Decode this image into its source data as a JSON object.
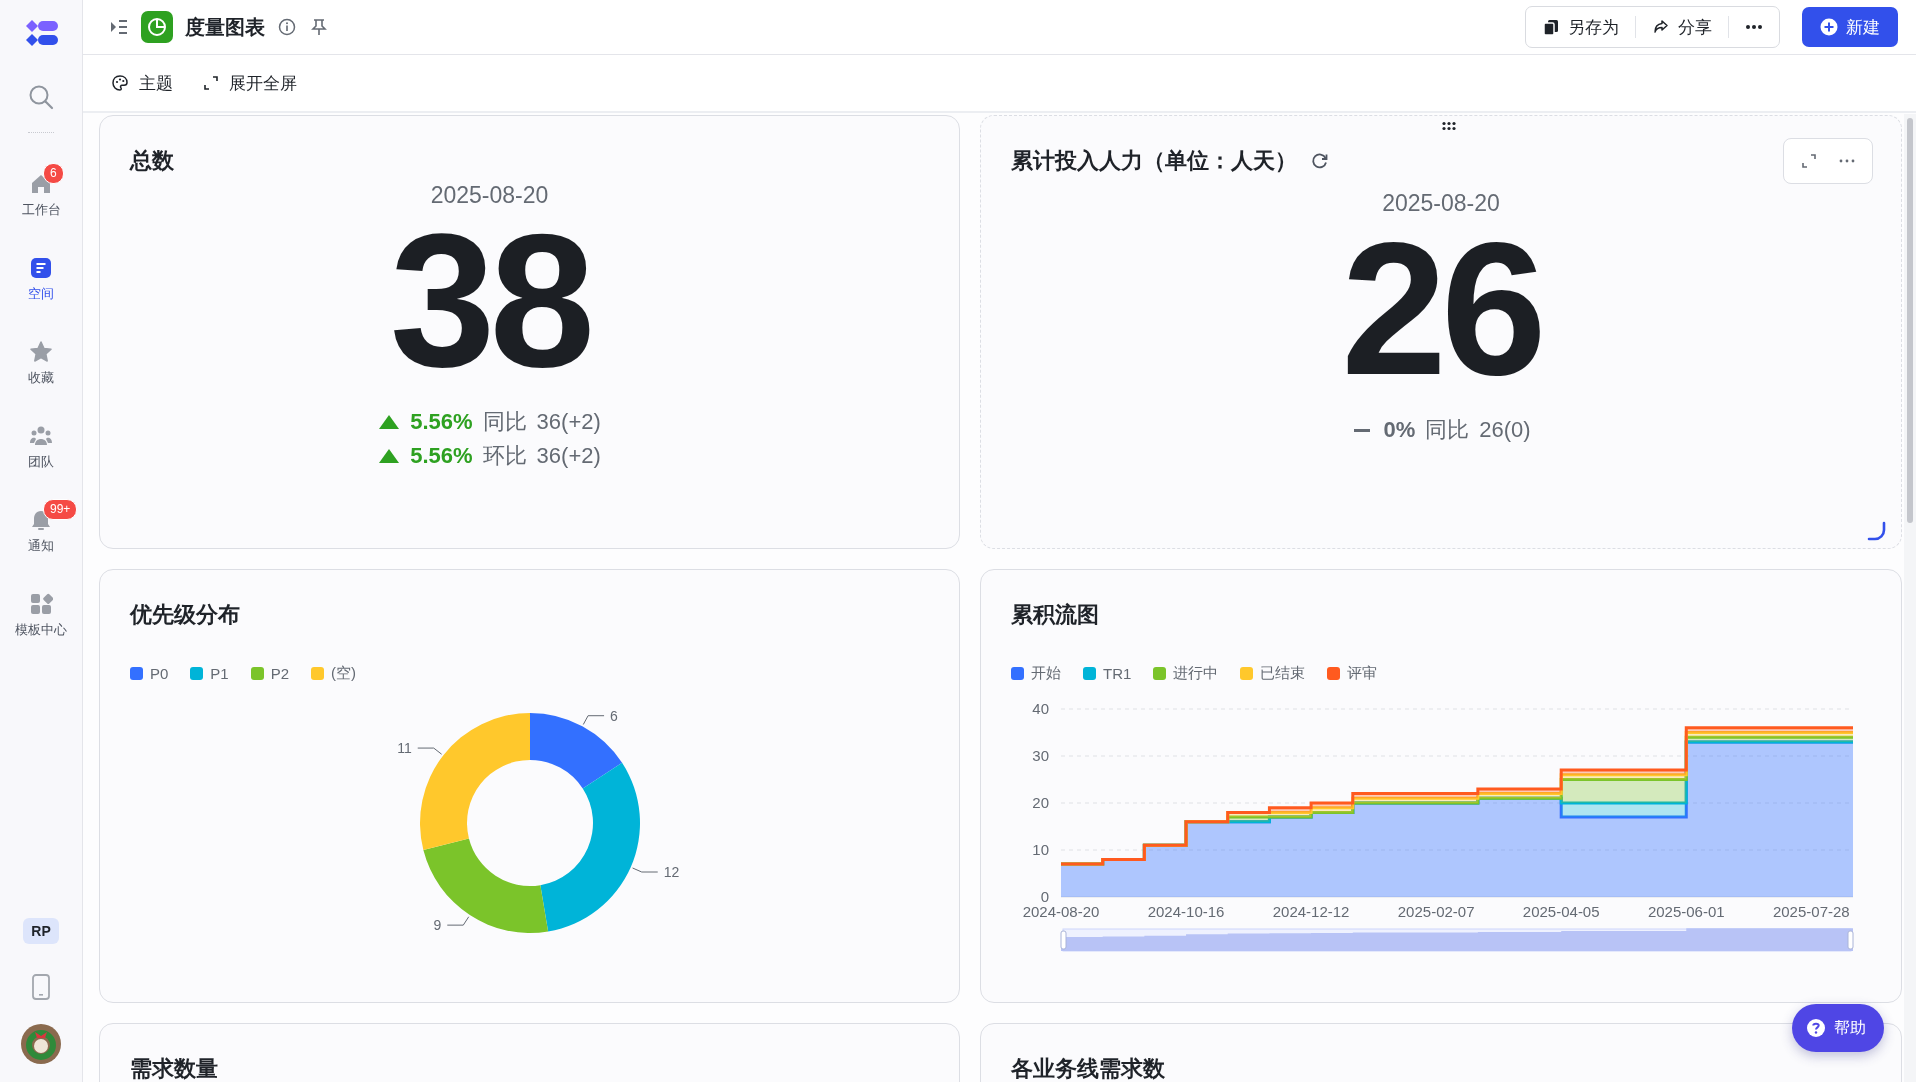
{
  "sidebar": {
    "items": [
      {
        "kind": "home",
        "label": "工作台",
        "badge": "6",
        "selected": false
      },
      {
        "kind": "space",
        "label": "空间",
        "selected": true
      },
      {
        "kind": "star",
        "label": "收藏",
        "selected": false
      },
      {
        "kind": "team",
        "label": "团队",
        "selected": false
      },
      {
        "kind": "bell",
        "label": "通知",
        "badge": "99+",
        "selected": false
      },
      {
        "kind": "apps",
        "label": "模板中心",
        "selected": false
      }
    ],
    "user_initials": "RP"
  },
  "header": {
    "title": "度量图表",
    "actions": [
      {
        "kind": "save",
        "label": "另存为"
      },
      {
        "kind": "share",
        "label": "分享"
      }
    ],
    "new_button": "新建"
  },
  "toolbar": [
    {
      "kind": "theme",
      "label": "主题"
    },
    {
      "kind": "fullscreen",
      "label": "展开全屏"
    }
  ],
  "cards": [
    {
      "kind": "metric",
      "title": "总数",
      "hovered": false,
      "loading": false,
      "date": "2025-08-20",
      "value": "38",
      "trends": [
        {
          "kind": "up",
          "percent": "5.56%",
          "label": "同比",
          "compare": "36(+2)"
        },
        {
          "kind": "up",
          "percent": "5.56%",
          "label": "环比",
          "compare": "36(+2)"
        }
      ]
    },
    {
      "kind": "metric",
      "title": "累计投入人力（单位：人天）",
      "hovered": true,
      "loading": true,
      "date": "2025-08-20",
      "value": "26",
      "trends": [
        {
          "kind": "flat",
          "percent": "0%",
          "label": "同比",
          "compare": "26(0)"
        }
      ]
    },
    {
      "kind": "donut",
      "title": "优先级分布",
      "chart_data": {
        "type": "donut",
        "categories": [
          "P0",
          "P1",
          "P2",
          "(空)"
        ],
        "values": [
          6,
          12,
          9,
          11
        ],
        "colors": [
          "#3370ff",
          "#00b4d8",
          "#7bc42a",
          "#ffc82c"
        ],
        "data_labels": true
      }
    },
    {
      "kind": "area",
      "title": "累积流图",
      "chart_data": {
        "type": "area",
        "stacked": true,
        "categories": [
          "2024-08-20",
          null,
          null,
          "2024-10-16",
          null,
          null,
          "2024-12-12",
          null,
          null,
          "2025-02-07",
          null,
          null,
          "2025-04-05",
          null,
          null,
          "2025-06-01",
          null,
          null,
          "2025-07-28",
          null
        ],
        "ylim": [
          0,
          40
        ],
        "yticks": [
          0,
          10,
          20,
          30,
          40
        ],
        "grid": true,
        "series": [
          {
            "name": "开始",
            "color": "#3370ff",
            "values": [
              7,
              8,
              11,
              16,
              16,
              17,
              18,
              20,
              20,
              20,
              21,
              21,
              17,
              17,
              17,
              33,
              33,
              33,
              33,
              33
            ]
          },
          {
            "name": "TR1",
            "color": "#00b4d8",
            "values": [
              0,
              0,
              0,
              0,
              0,
              0,
              0,
              0,
              0,
              0,
              0,
              0,
              3,
              3,
              3,
              0,
              0,
              0,
              0,
              0
            ]
          },
          {
            "name": "进行中",
            "color": "#7bc42a",
            "values": [
              0,
              0,
              0,
              0,
              1,
              0,
              0,
              0,
              0,
              0,
              0,
              0,
              5,
              5,
              5,
              1,
              1,
              1,
              1,
              1
            ]
          },
          {
            "name": "已结束",
            "color": "#ffc82c",
            "values": [
              0,
              0,
              0,
              0,
              1,
              1,
              1,
              1,
              1,
              1,
              1,
              1,
              1,
              1,
              1,
              1,
              1,
              1,
              1,
              1
            ]
          },
          {
            "name": "评审",
            "color": "#ff5a1f",
            "values": [
              0,
              0,
              0,
              0,
              0,
              1,
              1,
              1,
              1,
              1,
              1,
              1,
              1,
              1,
              1,
              1,
              1,
              1,
              1,
              1
            ]
          }
        ]
      }
    },
    {
      "kind": "partial",
      "title": "需求数量"
    },
    {
      "kind": "partial",
      "title": "各业务线需求数"
    }
  ],
  "help_button": "帮助"
}
